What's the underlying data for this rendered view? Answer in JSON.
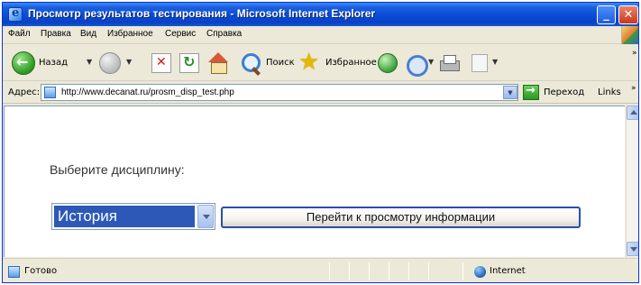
{
  "window": {
    "title": "Просмотр результатов тестирования - Microsoft Internet Explorer",
    "min_glyph": "_",
    "close_glyph": "✕"
  },
  "menu": {
    "items": [
      "Файл",
      "Правка",
      "Вид",
      "Избранное",
      "Сервис",
      "Справка"
    ]
  },
  "toolbar": {
    "back_label": "Назад",
    "search_label": "Поиск",
    "favorites_label": "Избранное",
    "dropdown_glyph": "▼",
    "more_glyph": "»",
    "favorites_glyph": "★"
  },
  "address": {
    "label": "Адрес:",
    "url": "http://www.decanat.ru/prosm_disp_test.php",
    "go_label": "Переход",
    "links_label": "Links",
    "more_glyph": "»"
  },
  "content": {
    "prompt": "Выберите дисциплину:",
    "selected_discipline": "История",
    "view_button_label": "Перейти к просмотру информации",
    "selection_color": "#2d58b8"
  },
  "status": {
    "text": "Готово",
    "zone": "Internet"
  }
}
